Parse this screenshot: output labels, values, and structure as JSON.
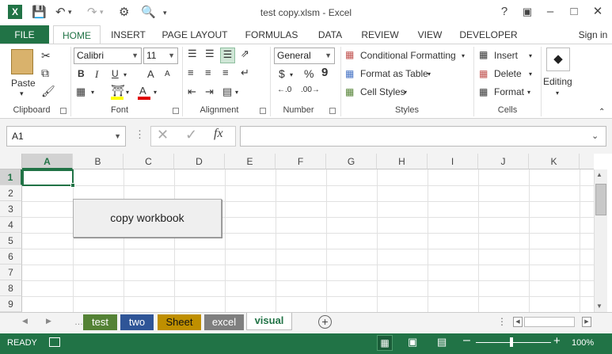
{
  "window": {
    "title": "test copy.xlsm - Excel",
    "help": "?",
    "sign_in": "Sign in"
  },
  "ribbon_tabs": [
    "FILE",
    "HOME",
    "INSERT",
    "PAGE LAYOUT",
    "FORMULAS",
    "DATA",
    "REVIEW",
    "VIEW",
    "DEVELOPER"
  ],
  "active_tab": "HOME",
  "clipboard": {
    "paste": "Paste",
    "label": "Clipboard"
  },
  "font": {
    "name": "Calibri",
    "size": "11",
    "bold": "B",
    "italic": "I",
    "underline": "U",
    "grow": "A",
    "shrink": "A",
    "label": "Font"
  },
  "alignment": {
    "label": "Alignment"
  },
  "number": {
    "format": "General",
    "currency": "$",
    "percent": "%",
    "comma": "9",
    "label": "Number"
  },
  "styles": {
    "conditional": "Conditional Formatting",
    "format_table": "Format as Table",
    "cell_styles": "Cell Styles",
    "label": "Styles"
  },
  "cells": {
    "insert": "Insert",
    "delete": "Delete",
    "format": "Format",
    "label": "Cells"
  },
  "editing": {
    "label": "Editing"
  },
  "formula_bar": {
    "name_box": "A1",
    "fx": "fx",
    "value": ""
  },
  "columns": [
    "A",
    "B",
    "C",
    "D",
    "E",
    "F",
    "G",
    "H",
    "I",
    "J",
    "K"
  ],
  "rows": [
    "1",
    "2",
    "3",
    "4",
    "5",
    "6",
    "7",
    "8",
    "9"
  ],
  "selected_cell": "A1",
  "form_button": "copy workbook",
  "sheets": [
    {
      "name": "test",
      "color": "#548235"
    },
    {
      "name": "two",
      "color": "#2f5597"
    },
    {
      "name": "Sheet",
      "color": "#bf8f00"
    },
    {
      "name": "excel",
      "color": "#7f7f7f"
    },
    {
      "name": "visual",
      "color": "#ffffff",
      "active": true
    }
  ],
  "status": {
    "mode": "READY",
    "zoom": "100%"
  },
  "colors": {
    "accent": "#217346"
  }
}
